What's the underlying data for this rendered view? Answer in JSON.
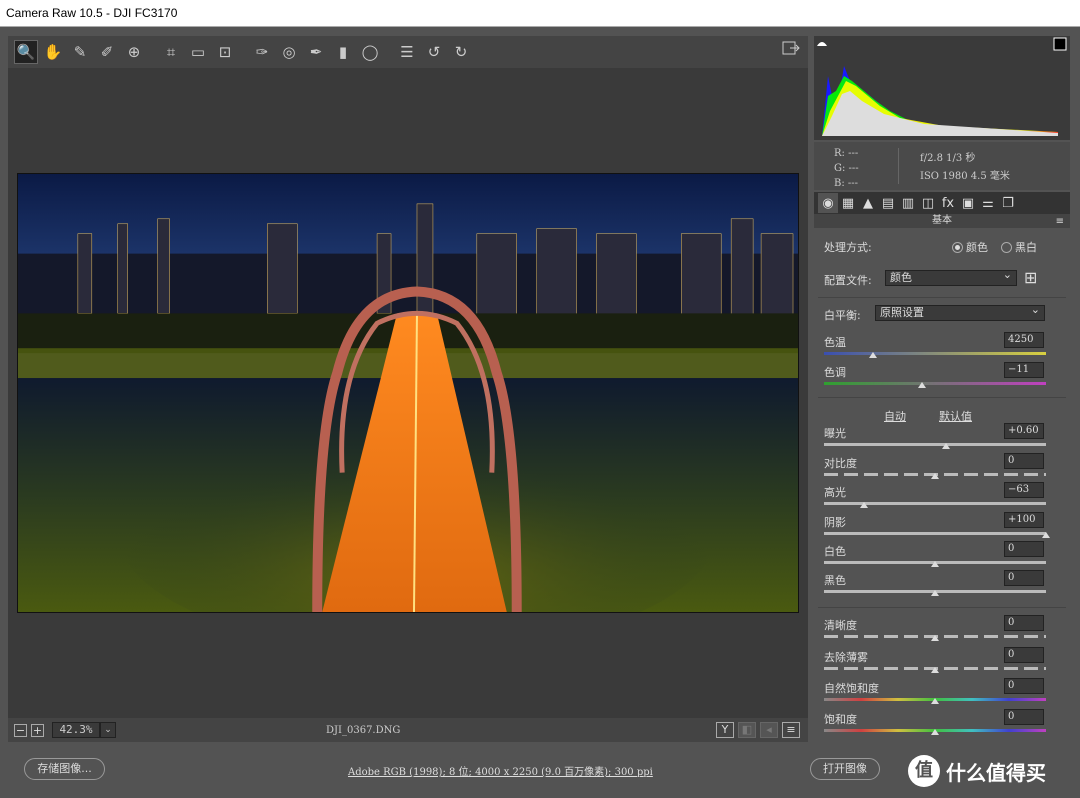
{
  "window": {
    "title": "Camera Raw 10.5 -  DJI FC3170"
  },
  "toolbar": {
    "tools": [
      "zoom-icon",
      "hand-icon",
      "eyedropper-icon",
      "color-sampler-icon",
      "target-adjust-icon",
      "crop-icon",
      "straighten-icon",
      "transform-icon",
      "spot-removal-icon",
      "redeye-icon",
      "adjustment-brush-icon",
      "graduated-filter-icon",
      "radial-filter-icon",
      "list-icon",
      "rotate-ccw-icon",
      "rotate-cw-icon"
    ],
    "active_tool": "zoom-icon"
  },
  "status": {
    "zoom_out": "−",
    "zoom_in": "+",
    "zoom": "42.3%",
    "zoom_dropdown": "⌄",
    "filename": "DJI_0367.DNG",
    "icons": [
      "Y",
      "◧",
      "◂",
      "≡"
    ]
  },
  "info": {
    "r": "R:   ---",
    "g": "G:   ---",
    "b": "B:   ---",
    "exif_line1": "f/2.8  1/3 秒",
    "exif_line2": "ISO 1980  4.5 毫米"
  },
  "panel": {
    "tabs": [
      "◉",
      "▦",
      "▲",
      "▤",
      "▥",
      "◫",
      "fx",
      "▣",
      "⚌",
      "❐"
    ],
    "title": "基本",
    "treatment_label": "处理方式:",
    "treatment_color": "颜色",
    "treatment_bw": "黑白",
    "profile_label": "配置文件:",
    "profile_value": "颜色",
    "wb_label": "白平衡:",
    "wb_value": "原照设置",
    "auto": "自动",
    "default": "默认值",
    "sliders": [
      {
        "label": "色温",
        "value": "4250",
        "level": 0.22
      },
      {
        "label": "色调",
        "value": "−11",
        "level": 0.44
      },
      {
        "label": "曝光",
        "value": "+0.60",
        "level": 0.55
      },
      {
        "label": "对比度",
        "value": "0",
        "level": 0.5
      },
      {
        "label": "高光",
        "value": "−63",
        "level": 0.18
      },
      {
        "label": "阴影",
        "value": "+100",
        "level": 1.0
      },
      {
        "label": "白色",
        "value": "0",
        "level": 0.5
      },
      {
        "label": "黑色",
        "value": "0",
        "level": 0.5
      },
      {
        "label": "清晰度",
        "value": "0",
        "level": 0.5
      },
      {
        "label": "去除薄雾",
        "value": "0",
        "level": 0.5
      },
      {
        "label": "自然饱和度",
        "value": "0",
        "level": 0.5
      },
      {
        "label": "饱和度",
        "value": "0",
        "level": 0.5
      }
    ]
  },
  "bottom": {
    "save": "存储图像...",
    "workflow": "Adobe RGB (1998); 8 位; 4000 x 2250 (9.0 百万像素); 300 ppi",
    "open": "打开图像",
    "watermark": "什么值得买",
    "watermark_icon": "值"
  }
}
